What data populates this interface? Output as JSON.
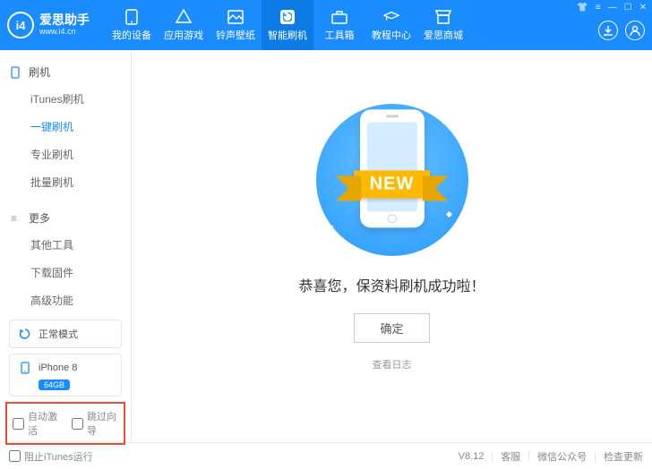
{
  "brand": {
    "name": "爱思助手",
    "url": "www.i4.cn",
    "logo_text": "i4"
  },
  "top_tabs": [
    {
      "label": "我的设备"
    },
    {
      "label": "应用游戏"
    },
    {
      "label": "铃声壁纸"
    },
    {
      "label": "智能刷机"
    },
    {
      "label": "工具箱"
    },
    {
      "label": "教程中心"
    },
    {
      "label": "爱思商城"
    }
  ],
  "active_top_tab_index": 3,
  "sidebar": {
    "flash": {
      "title": "刷机",
      "items": [
        {
          "label": "iTunes刷机"
        },
        {
          "label": "一键刷机"
        },
        {
          "label": "专业刷机"
        },
        {
          "label": "批量刷机"
        }
      ],
      "active_index": 1
    },
    "more": {
      "title": "更多",
      "items": [
        {
          "label": "其他工具"
        },
        {
          "label": "下载固件"
        },
        {
          "label": "高级功能"
        }
      ]
    },
    "mode_label": "正常模式",
    "device": {
      "name": "iPhone 8",
      "storage": "64GB"
    },
    "auto_activate_label": "自动激活",
    "skip_guide_label": "跳过向导"
  },
  "content": {
    "ribbon_text": "NEW",
    "success_text": "恭喜您，保资料刷机成功啦！",
    "ok_button": "确定",
    "view_log": "查看日志"
  },
  "footer": {
    "block_itunes_label": "阻止iTunes运行",
    "version": "V8.12",
    "links": [
      "客服",
      "微信公众号",
      "检查更新"
    ]
  }
}
